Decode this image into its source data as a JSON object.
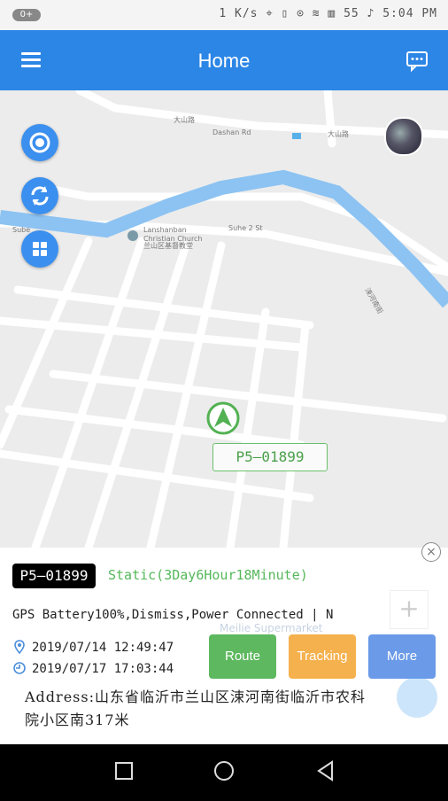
{
  "status": {
    "left_badge": "0+",
    "right_text": "1 K/s ⌖ ▯ ⊙ ≋ ▥ 55 ♪ 5:04 PM"
  },
  "header": {
    "title": "Home",
    "menu_icon": "hamburger-icon",
    "chat_icon": "chat-icon"
  },
  "map": {
    "labels": {
      "road_top": "大山路",
      "road_top_en": "Dashan Rd",
      "road_top_right": "大山路",
      "church_en1": "Lanshanban",
      "church_en2": "Christian Church",
      "church_cn": "兰山区基督教堂",
      "road_left": "Sube",
      "road_mid": "Suhe 2 St",
      "road_right": "涑河南街"
    },
    "marker_label": "P5—01899",
    "accent": "#2c86e6"
  },
  "panel": {
    "plate": "P5—01899",
    "status": "Static(3Day6Hour18Minute)",
    "info": "GPS Battery100%,Dismiss,Power Connected | N",
    "faint_poi": "Meilie Supermarket",
    "time1": "2019/07/14 12:49:47",
    "time2": "2019/07/17 17:03:44",
    "buttons": [
      {
        "label": "Route",
        "color": "#5db85f"
      },
      {
        "label": "Tracking",
        "color": "#f5b14e"
      },
      {
        "label": "More",
        "color": "#6a9ae8"
      }
    ],
    "address_line1": "Address:山东省临沂市兰山区涑河南街临沂市农科",
    "address_line2": "院小区南317米",
    "close_label": "×",
    "zoom_label": "+"
  }
}
